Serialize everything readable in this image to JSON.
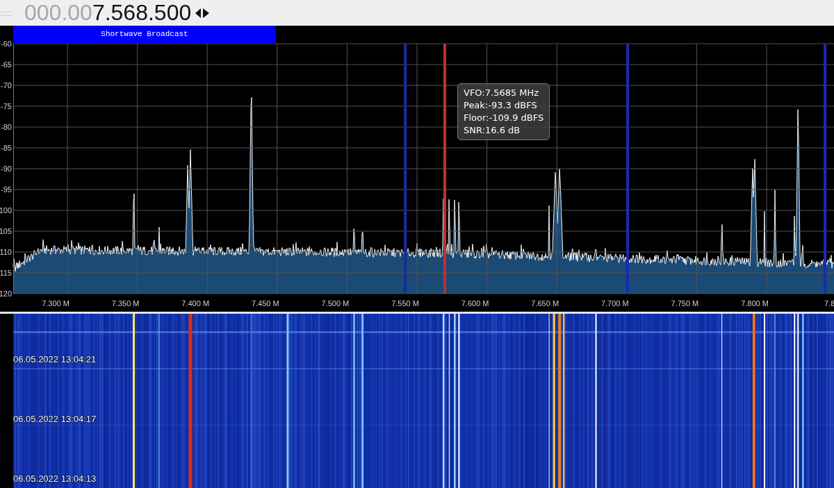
{
  "frequency_display": {
    "dim_digits": "000.00",
    "bright_digits": "7.568.500"
  },
  "spectrum": {
    "band_label": "Shortwave Broadcast",
    "y_axis_labels": [
      "-60",
      "-65",
      "-70",
      "-75",
      "-80",
      "-85",
      "-90",
      "-95",
      "100",
      "105",
      "110",
      "115",
      "120"
    ],
    "x_axis_labels": [
      "7.300 M",
      "7.350 M",
      "7.400 M",
      "7.450 M",
      "7.500 M",
      "7.550 M",
      "7.600 M",
      "7.650 M",
      "7.700 M",
      "7.750 M",
      "7.800 M",
      "7.8"
    ],
    "tooltip": [
      "VFO:7.5685 MHz",
      "Peak:-93.3 dBFS",
      "Floor:-109.9 dBFS",
      "SNR:16.6 dB"
    ]
  },
  "waterfall": {
    "timestamps": [
      "06.05.2022 13:04:21",
      "06.05.2022 13:04:17",
      "06.05.2022 13:04:13"
    ]
  }
}
